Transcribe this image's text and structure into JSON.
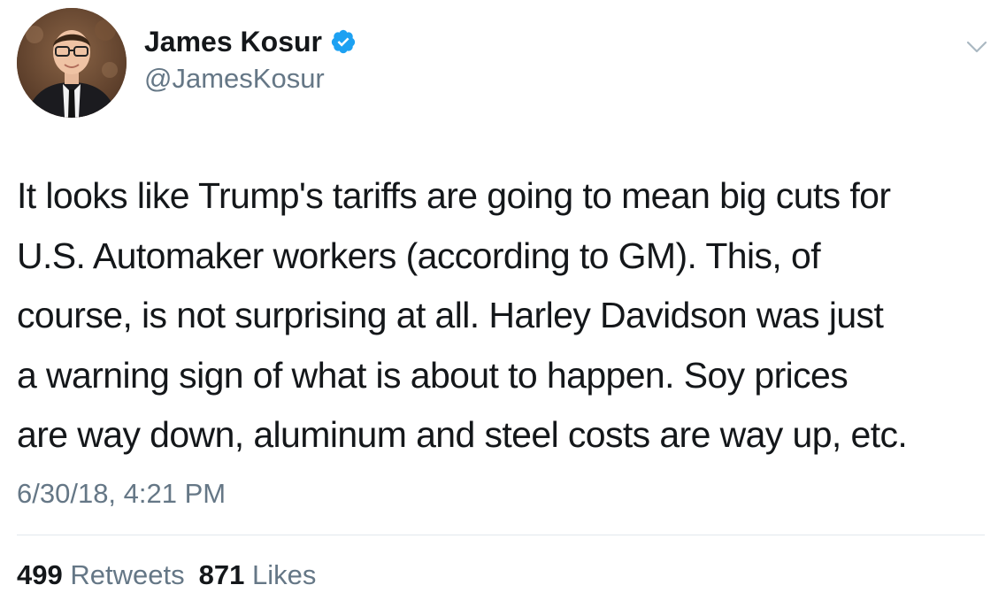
{
  "author": {
    "display_name": "James Kosur",
    "handle": "@JamesKosur",
    "verified": true,
    "verified_icon": "verified-badge-icon",
    "avatar": "profile-photo"
  },
  "tweet": {
    "lines": [
      "It looks like Trump's tariffs are going to mean big cuts for",
      "U.S. Automaker workers (according to GM). This, of",
      "course, is not surprising at all. Harley Davidson was just",
      "a warning sign of what is about to happen. Soy prices",
      "are way down, aluminum and steel costs are way up, etc."
    ],
    "timestamp": "6/30/18, 4:21 PM"
  },
  "stats": {
    "retweets_count": "499",
    "retweets_label": "Retweets",
    "likes_count": "871",
    "likes_label": "Likes"
  },
  "menu": {
    "icon": "chevron-down-icon"
  },
  "colors": {
    "text_primary": "#14171a",
    "text_secondary": "#657786",
    "verified_blue": "#1da1f2",
    "divider": "#e1e8ed",
    "background": "#ffffff"
  }
}
